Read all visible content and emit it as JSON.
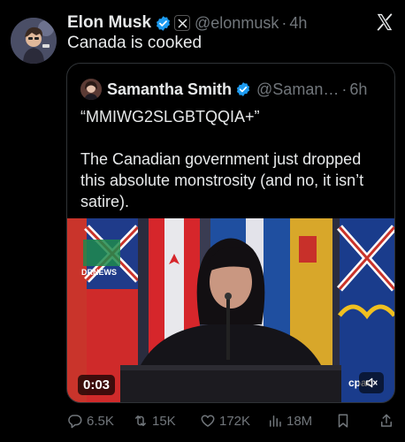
{
  "tweet": {
    "author_name": "Elon Musk",
    "handle": "@elonmusk",
    "separator": "·",
    "time": "4h",
    "text": "Canada is cooked"
  },
  "quote": {
    "author_name": "Samantha Smith",
    "handle": "@Saman…",
    "separator": "·",
    "time": "6h",
    "lines": [
      "“MMIWG2SLGBTQQIA+”",
      "The Canadian government just dropped this absolute monstrosity (and no, it isn’t satire)."
    ],
    "video": {
      "duration": "0:03",
      "logo_text": "DRNEWS",
      "watermark": "cpac"
    }
  },
  "actions": {
    "replies": "6.5K",
    "reposts": "15K",
    "likes": "172K",
    "views": "18M"
  },
  "colors": {
    "background": "#000000",
    "text": "#e7e9ea",
    "muted": "#71767b",
    "verified": "#1d9bf0",
    "border": "#2f3336"
  },
  "icons": {
    "verified": "verified-badge-icon",
    "x_badge": "x-affiliate-icon",
    "x_logo": "x-logo-icon",
    "reply": "reply-icon",
    "repost": "repost-icon",
    "like": "heart-icon",
    "views": "views-icon",
    "bookmark": "bookmark-icon",
    "share": "share-icon",
    "mute": "mute-icon"
  }
}
